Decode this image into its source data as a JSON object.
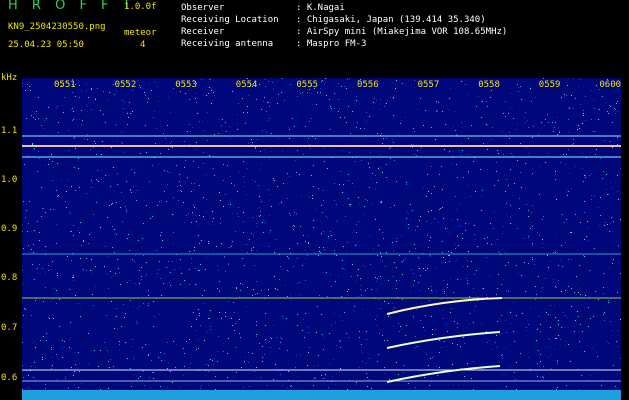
{
  "app": {
    "title": "H R O F F T",
    "version": "1.0.0f",
    "mode": "meteor",
    "count": "4"
  },
  "file": {
    "name": "KN9_2504230550.png",
    "datetime": "25.04.23 05:50"
  },
  "header": [
    {
      "label": "Observer",
      "value": ": K.Nagai"
    },
    {
      "label": "Receiving Location",
      "value": ": Chigasaki, Japan (139.414 35.340)"
    },
    {
      "label": "Receiver",
      "value": ": AirSpy mini (Miakejima VOR 108.65MHz)"
    },
    {
      "label": "Receiving antenna",
      "value": ": Maspro FM-3"
    }
  ],
  "axis": {
    "y_unit": "kHz",
    "y_ticks": [
      "1.1",
      "1.0",
      "0.9",
      "0.8",
      "0.7",
      "0.6"
    ],
    "x_ticks": [
      "0551",
      "0552",
      "0553",
      "0554",
      "0555",
      "0556",
      "0557",
      "0558",
      "0559",
      "0600"
    ]
  },
  "colors": {
    "background": "#00077a",
    "tick_text": "#f2e400",
    "title": "#2fd15a",
    "signal": "#fff7c0"
  }
}
